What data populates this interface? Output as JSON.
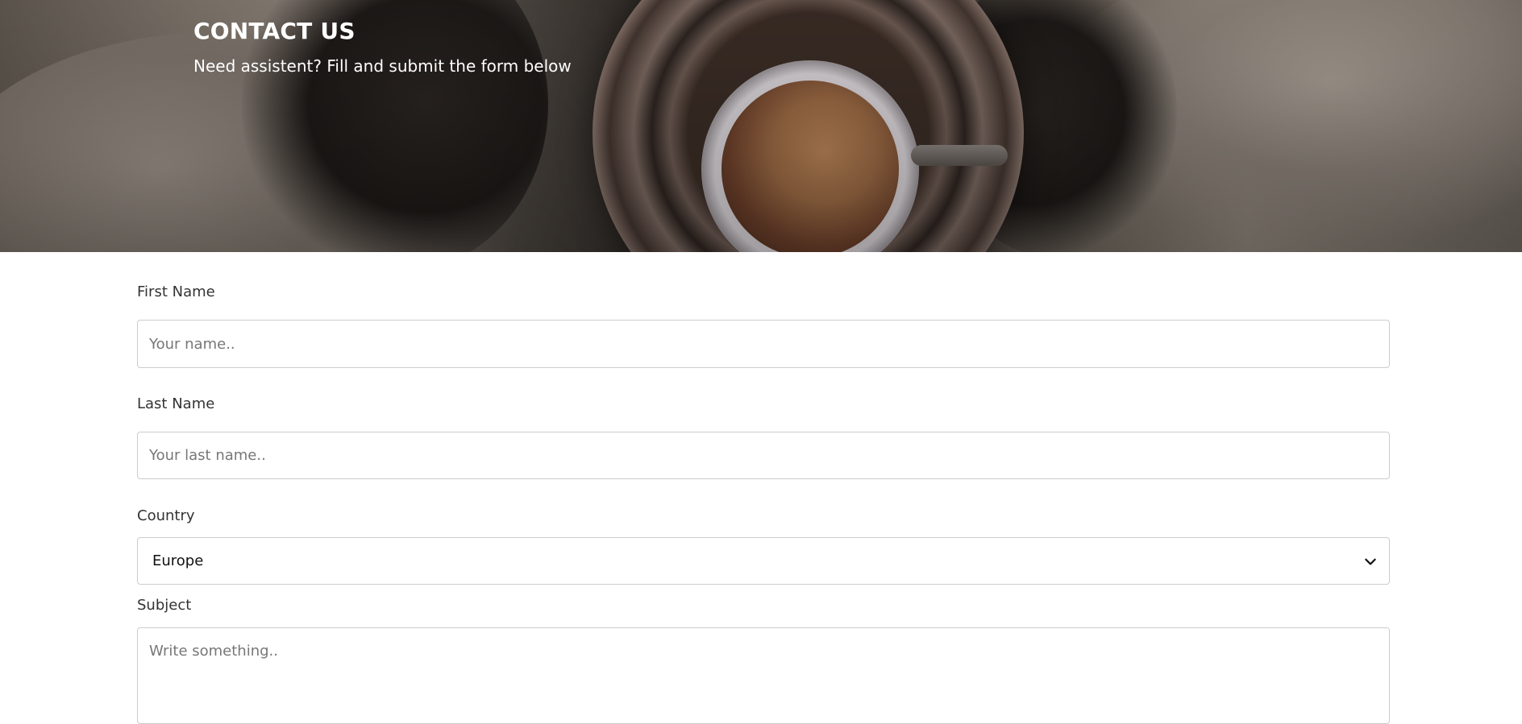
{
  "hero": {
    "title": "CONTACT US",
    "subtitle": "Need assistent? Fill and submit the form below"
  },
  "form": {
    "first_name": {
      "label": "First Name",
      "placeholder": "Your name..",
      "value": ""
    },
    "last_name": {
      "label": "Last Name",
      "placeholder": "Your last name..",
      "value": ""
    },
    "country": {
      "label": "Country",
      "selected": "Europe",
      "icon": "chevron-down-icon"
    },
    "subject": {
      "label": "Subject",
      "placeholder": "Write something..",
      "value": ""
    }
  },
  "colors": {
    "hero_text": "#ffffff",
    "label_text": "#333333",
    "border": "#cccccc"
  }
}
